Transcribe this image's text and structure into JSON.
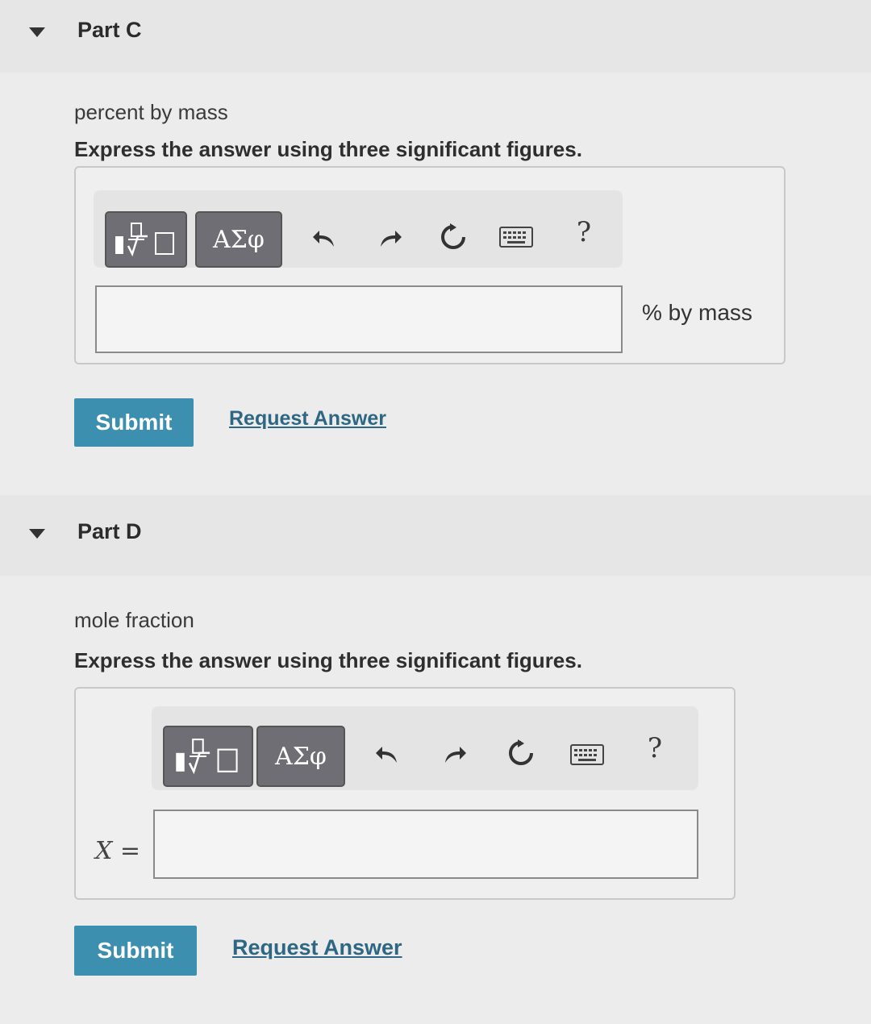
{
  "part_c": {
    "title": "Part C",
    "prompt": "percent by mass",
    "instruction": "Express the answer using three significant figures.",
    "toolbar": {
      "templates_icon": "fraction-sqrt-template-icon",
      "greek_label": "ΑΣφ",
      "help_label": "?"
    },
    "answer_value": "",
    "unit": "% by mass",
    "submit_label": "Submit",
    "request_answer_label": "Request Answer"
  },
  "part_d": {
    "title": "Part D",
    "prompt": "mole fraction",
    "instruction": "Express the answer using three significant figures.",
    "toolbar": {
      "templates_icon": "fraction-sqrt-template-icon",
      "greek_label": "ΑΣφ",
      "help_label": "?"
    },
    "variable_label": "X =",
    "answer_value": "",
    "submit_label": "Submit",
    "request_answer_label": "Request Answer"
  },
  "colors": {
    "submit": "#3d8fb0",
    "link": "#2d6784",
    "toolbar_button": "#6e6e74"
  }
}
